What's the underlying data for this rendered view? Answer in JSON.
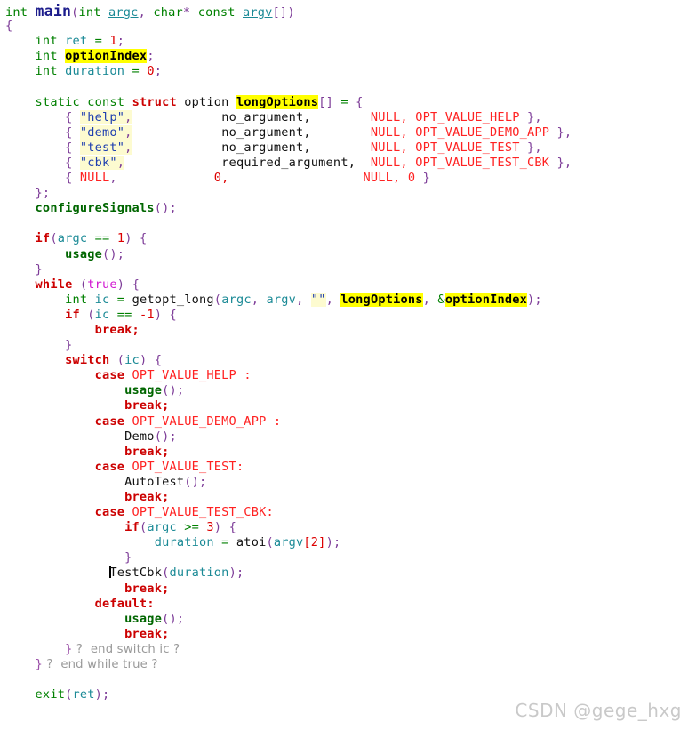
{
  "editor": {
    "language": "C",
    "function_name": "main",
    "search_highlight_terms": [
      "optionIndex",
      "longOptions"
    ],
    "caret_line": 37,
    "caret_column": 13
  },
  "colors": {
    "keyword": "#cc0000",
    "type": "#008000",
    "function": "#006600",
    "variable": "#1b8a96",
    "number": "#dd0000",
    "constant": "#ff2222",
    "punctuation": "#7d3c98",
    "string_fg": "#1f3fb0",
    "string_bg": "#fdfbd0",
    "highlight_bg": "#ffff00",
    "comment": "#9a9a9a",
    "main_identifier": "#1c1c8c",
    "boolean": "#d11ad1",
    "background": "#ffffff"
  },
  "watermark": {
    "text": "CSDN @gege_hxg"
  },
  "code": {
    "lines": [
      "int main(int argc, char* const argv[])",
      "{",
      "    int ret = 1;",
      "    int optionIndex;",
      "    int duration = 0;",
      "",
      "    static const struct option longOptions[] = {",
      "        { \"help\",          no_argument,        NULL, OPT_VALUE_HELP },",
      "        { \"demo\",          no_argument,        NULL, OPT_VALUE_DEMO_APP },",
      "        { \"test\",          no_argument,        NULL, OPT_VALUE_TEST },",
      "        { \"cbk\",           required_argument,  NULL, OPT_VALUE_TEST_CBK },",
      "        { NULL,            0,                  NULL, 0 }",
      "    };",
      "    configureSignals();",
      "",
      "    if(argc == 1) {",
      "        usage();",
      "    }",
      "    while (true) {",
      "        int ic = getopt_long(argc, argv, \"\", longOptions, &optionIndex);",
      "        if (ic == -1) {",
      "            break;",
      "        }",
      "        switch (ic) {",
      "            case OPT_VALUE_HELP :",
      "                usage();",
      "                break;",
      "            case OPT_VALUE_DEMO_APP :",
      "                Demo();",
      "                break;",
      "            case OPT_VALUE_TEST:",
      "                AutoTest();",
      "                break;",
      "            case OPT_VALUE_TEST_CBK:",
      "                if(argc >= 3) {",
      "                    duration = atoi(argv[2]);",
      "                }",
      "                TestCbk(duration);",
      "                break;",
      "            default:",
      "                usage();",
      "                break;",
      "        } ?  end switch ic ?",
      "    } ?  end while true ?",
      "",
      "    exit(ret);"
    ],
    "tokens": {
      "line1": {
        "t1": "int ",
        "t2": "main",
        "t3": "(",
        "t4": "int ",
        "t5": "argc",
        "t6": ", ",
        "t7": "char",
        "t8": "* ",
        "t9": "const ",
        "t10": "argv",
        "t11": "[]",
        "t12": ")"
      },
      "line2": {
        "brace": "{"
      },
      "line3": {
        "type": "int ",
        "name": "ret",
        "op": " = ",
        "num": "1",
        "semi": ";"
      },
      "line4": {
        "type": "int ",
        "name": "optionIndex",
        "semi": ";"
      },
      "line5": {
        "type": "int ",
        "name": "duration",
        "op": " = ",
        "num": "0",
        "semi": ";"
      },
      "line7": {
        "static": "static ",
        "const": "const ",
        "struct": "struct ",
        "option": "option ",
        "name": "longOptions",
        "brackets": "[]",
        "op": " = ",
        "brace": "{"
      },
      "struct_rows": [
        {
          "open": "{ ",
          "name": "\"help\"",
          "comma1": ",",
          "pad1": "            ",
          "arg": "no_argument,",
          "pad2": "        ",
          "null": "NULL,",
          "pad3": " ",
          "value": "OPT_VALUE_HELP",
          "close": " },"
        },
        {
          "open": "{ ",
          "name": "\"demo\"",
          "comma1": ",",
          "pad1": "            ",
          "arg": "no_argument,",
          "pad2": "        ",
          "null": "NULL,",
          "pad3": " ",
          "value": "OPT_VALUE_DEMO_APP",
          "close": " },"
        },
        {
          "open": "{ ",
          "name": "\"test\"",
          "comma1": ",",
          "pad1": "            ",
          "arg": "no_argument,",
          "pad2": "        ",
          "null": "NULL,",
          "pad3": " ",
          "value": "OPT_VALUE_TEST",
          "close": " },"
        },
        {
          "open": "{ ",
          "name": "\"cbk\"",
          "comma1": ",",
          "pad1": "             ",
          "arg": "required_argument,",
          "pad2": "  ",
          "null": "NULL,",
          "pad3": " ",
          "value": "OPT_VALUE_TEST_CBK",
          "close": " },"
        },
        {
          "open": "{ ",
          "name": "NULL",
          "comma1": ",",
          "pad1": "             ",
          "arg": "0,",
          "pad2": "                  ",
          "null": "NULL,",
          "pad3": " ",
          "value": "0",
          "close": " }"
        }
      ],
      "line13": {
        "close": "};"
      },
      "line14": {
        "fn": "configureSignals",
        "parens": "();"
      },
      "line16": {
        "kw": "if",
        "open": "(",
        "var": "argc",
        "op": " == ",
        "num": "1",
        "close": ") ",
        "brace": "{"
      },
      "line17": {
        "fn": "usage",
        "parens": "();"
      },
      "line18": {
        "brace": "}"
      },
      "line19": {
        "kw": "while ",
        "open": "(",
        "bool": "true",
        "close": ") ",
        "brace": "{"
      },
      "line20": {
        "type": "int ",
        "var": "ic",
        "op": " = ",
        "fn": "getopt_long",
        "open": "(",
        "a1": "argc",
        "c1": ", ",
        "a2": "argv",
        "c2": ", ",
        "str": "\"\"",
        "c3": ", ",
        "a3": "longOptions",
        "c4": ", ",
        "amp": "&",
        "a4": "optionIndex",
        "close": ");"
      },
      "line21": {
        "kw": "if ",
        "open": "(",
        "var": "ic",
        "op": " == ",
        "num": "-1",
        "close": ") ",
        "brace": "{"
      },
      "line22": {
        "kw": "break;"
      },
      "line23": {
        "brace": "}"
      },
      "line24": {
        "kw": "switch ",
        "open": "(",
        "var": "ic",
        "close": ") ",
        "brace": "{"
      },
      "cases": [
        {
          "kw": "case ",
          "label": "OPT_VALUE_HELP",
          "colon": " :",
          "body_fn": "usage",
          "body_parens": "();",
          "body_kind": "fn",
          "brk": "break;"
        },
        {
          "kw": "case ",
          "label": "OPT_VALUE_DEMO_APP",
          "colon": " :",
          "body_fn": "Demo",
          "body_parens": "();",
          "body_kind": "plain",
          "brk": "break;"
        },
        {
          "kw": "case ",
          "label": "OPT_VALUE_TEST",
          "colon": ":",
          "body_fn": "AutoTest",
          "body_parens": "();",
          "body_kind": "plain",
          "brk": "break;"
        }
      ],
      "case_cbk": {
        "kw": "case ",
        "label": "OPT_VALUE_TEST_CBK",
        "colon": ":"
      },
      "line33": {
        "kw": "if",
        "open": "(",
        "var": "argc",
        "op": " >= ",
        "num": "3",
        "close": ") ",
        "brace": "{"
      },
      "line34": {
        "var": "duration",
        "op": " = ",
        "fn": "atoi",
        "open": "(",
        "arg": "argv",
        "idx": "[2]",
        "close": ");"
      },
      "line35": {
        "brace": "}"
      },
      "line36": {
        "fn": "TestCbk",
        "open": "(",
        "arg": "duration",
        "close": ");"
      },
      "line37": {
        "kw": "break;"
      },
      "line38": {
        "kw": "default:"
      },
      "line39": {
        "fn": "usage",
        "parens": "();"
      },
      "line40": {
        "kw": "break;"
      },
      "line41": {
        "brace": "}",
        "comment": " ?  end switch ic ?"
      },
      "line42": {
        "brace": "}",
        "comment": " ?  end while true ?"
      },
      "line44": {
        "fn": "exit",
        "open": "(",
        "arg": "ret",
        "close": ");"
      }
    }
  }
}
